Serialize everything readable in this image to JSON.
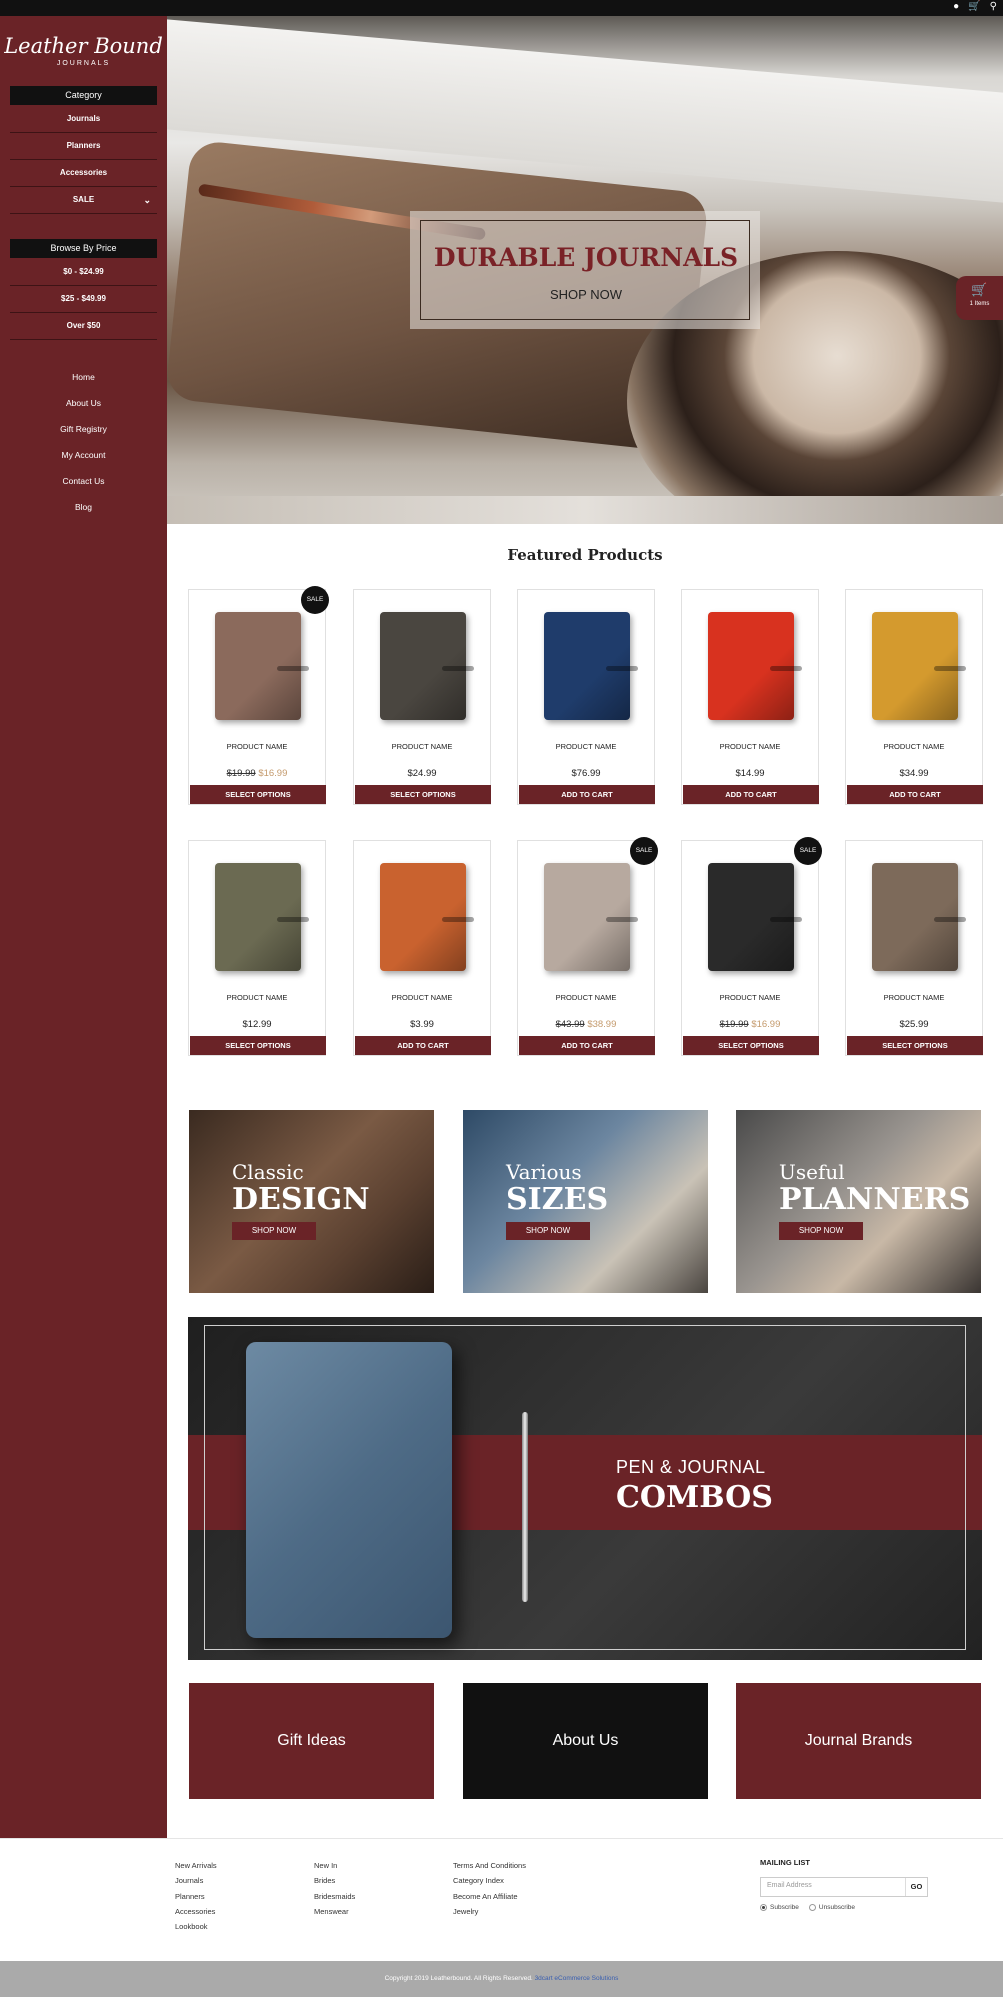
{
  "brand": {
    "logo_line1": "Leather Bound",
    "logo_line2": "JOURNALS"
  },
  "topbar": {
    "icons": [
      "user-icon",
      "cart-icon",
      "search-icon"
    ]
  },
  "sidebar": {
    "category_heading": "Category",
    "categories": [
      "Journals",
      "Planners",
      "Accessories",
      "SALE"
    ],
    "price_heading": "Browse By Price",
    "prices": [
      "$0 - $24.99",
      "$25 - $49.99",
      "Over $50"
    ],
    "nav": [
      "Home",
      "About Us",
      "Gift Registry",
      "My Account",
      "Contact Us",
      "Blog"
    ]
  },
  "hero": {
    "title": "DURABLE JOURNALS",
    "cta": "SHOP NOW"
  },
  "cart": {
    "count_label": "1 Items"
  },
  "featured": {
    "title": "Featured Products",
    "products": [
      {
        "name": "PRODUCT NAME",
        "price": "",
        "old_price": "$19.99",
        "new_price": "$16.99",
        "button": "SELECT OPTIONS",
        "sale": "SALE",
        "color": "#8b6a5c"
      },
      {
        "name": "PRODUCT NAME",
        "price": "$24.99",
        "old_price": "",
        "new_price": "",
        "button": "SELECT OPTIONS",
        "sale": "",
        "color": "#4a4640"
      },
      {
        "name": "PRODUCT NAME",
        "price": "$76.99",
        "old_price": "",
        "new_price": "",
        "button": "ADD TO CART",
        "sale": "",
        "color": "#1f3c6b"
      },
      {
        "name": "PRODUCT NAME",
        "price": "$14.99",
        "old_price": "",
        "new_price": "",
        "button": "ADD TO CART",
        "sale": "",
        "color": "#d8321f"
      },
      {
        "name": "PRODUCT NAME",
        "price": "$34.99",
        "old_price": "",
        "new_price": "",
        "button": "ADD TO CART",
        "sale": "",
        "color": "#d49a2e"
      },
      {
        "name": "PRODUCT NAME",
        "price": "$12.99",
        "old_price": "",
        "new_price": "",
        "button": "SELECT OPTIONS",
        "sale": "",
        "color": "#6b6a52"
      },
      {
        "name": "PRODUCT NAME",
        "price": "$3.99",
        "old_price": "",
        "new_price": "",
        "button": "ADD TO CART",
        "sale": "",
        "color": "#c9622f"
      },
      {
        "name": "PRODUCT NAME",
        "price": "",
        "old_price": "$43.99",
        "new_price": "$38.99",
        "button": "ADD TO CART",
        "sale": "SALE",
        "color": "#b7a99f"
      },
      {
        "name": "PRODUCT NAME",
        "price": "",
        "old_price": "$19.99",
        "new_price": "$16.99",
        "button": "SELECT OPTIONS",
        "sale": "SALE",
        "color": "#2a2a2a"
      },
      {
        "name": "PRODUCT NAME",
        "price": "$25.99",
        "old_price": "",
        "new_price": "",
        "button": "SELECT OPTIONS",
        "sale": "",
        "color": "#7d6a5a"
      }
    ]
  },
  "promos": [
    {
      "line1": "Classic",
      "line2": "DESIGN",
      "button": "SHOP NOW"
    },
    {
      "line1": "Various",
      "line2": "SIZES",
      "button": "SHOP NOW"
    },
    {
      "line1": "Useful",
      "line2": "PLANNERS",
      "button": "SHOP NOW"
    }
  ],
  "combo": {
    "line1": "PEN & JOURNAL",
    "line2": "COMBOS"
  },
  "tiles": [
    "Gift Ideas",
    "About Us",
    "Journal Brands"
  ],
  "footer": {
    "col1": [
      "New Arrivals",
      "Journals",
      "Planners",
      "Accessories",
      "Lookbook"
    ],
    "col2": [
      "New In",
      "Brides",
      "Bridesmaids",
      "Menswear"
    ],
    "col3": [
      "Terms And Conditions",
      "Category Index",
      "Become An Affiliate",
      "Jewelry"
    ],
    "mailing": {
      "heading": "MAILING LIST",
      "placeholder": "Email Address",
      "go": "GO",
      "subscribe": "Subscribe",
      "unsubscribe": "Unsubscribe"
    },
    "copyright": "Copyright 2019 Leatherbound. All Rights Reserved.",
    "credit": "3dcart eCommerce Solutions"
  },
  "colors": {
    "brand": "#6a2327",
    "dark": "#111111",
    "sale_price": "#c49a6c"
  }
}
